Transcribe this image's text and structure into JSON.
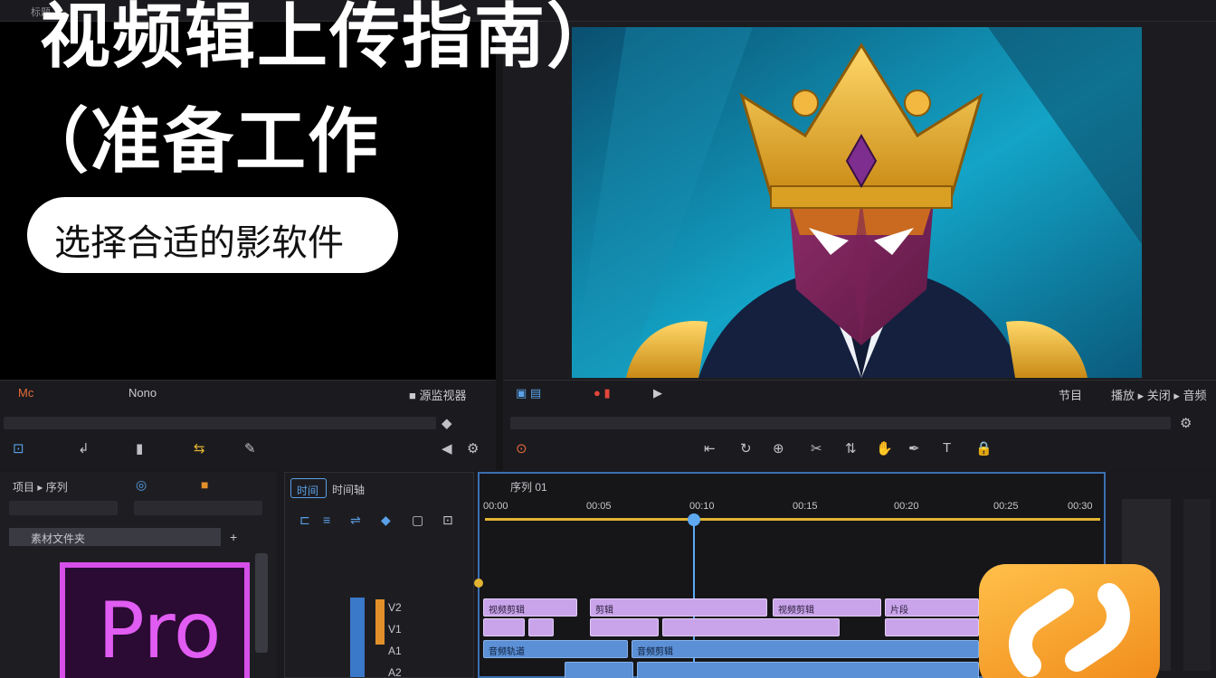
{
  "topbar": {
    "tag": "标题"
  },
  "overlay": {
    "title_line_1": "视频辑上传指南）",
    "title_line_2": "（准备工作",
    "subtitle": "选择合适的影软件"
  },
  "source_strip": {
    "left_label": "Mc",
    "mid_label": "Nono",
    "right_label": "■ 源监视器"
  },
  "program_strip": {
    "right_label_1": "节目",
    "right_label_2": "播放 ▸ 关闭 ▸ 音频"
  },
  "project_panel": {
    "title": "项目 ▸ 序列",
    "bin": "素材文件夹"
  },
  "track_header": {
    "tab_active": "时间",
    "tab_other": "时间轴",
    "tracks": [
      "V2",
      "V1",
      "A1",
      "A2"
    ]
  },
  "timeline": {
    "sequence_name": "序列 01",
    "ticks": [
      "00:00",
      "00:05",
      "00:10",
      "00:15",
      "00:20",
      "00:25",
      "00:30"
    ],
    "video_clips": [
      "视频剪辑",
      "剪辑",
      "视频剪辑",
      "片段"
    ],
    "audio_clips": [
      "音频轨道",
      "音频剪辑"
    ]
  },
  "logos": {
    "premiere": "Pro"
  },
  "colors": {
    "accent_blue": "#3b6fb0",
    "playhead": "#5ea9f0",
    "ruler": "#e2b432",
    "video_clip": "#c9a4ea",
    "audio_clip": "#5b8fd6",
    "premiere_purple": "#d64fe8",
    "app_orange": "#f5a02c"
  }
}
